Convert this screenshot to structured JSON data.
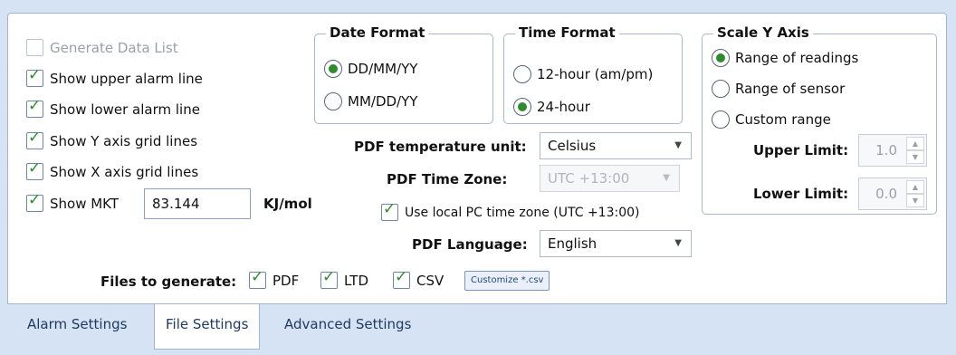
{
  "options": {
    "generate_data_list": "Generate Data List",
    "show_upper_alarm": "Show upper alarm line",
    "show_lower_alarm": "Show lower alarm line",
    "show_y_grid": "Show Y axis grid lines",
    "show_x_grid": "Show X axis grid lines",
    "show_mkt": "Show MKT",
    "mkt_value": "83.144",
    "mkt_unit": "KJ/mol"
  },
  "date_format": {
    "legend": "Date Format",
    "opt1": "DD/MM/YY",
    "opt2": "MM/DD/YY",
    "selected": "DD/MM/YY"
  },
  "time_format": {
    "legend": "Time Format",
    "opt1": "12-hour (am/pm)",
    "opt2": "24-hour",
    "selected": "24-hour"
  },
  "scale_y": {
    "legend": "Scale Y Axis",
    "opt1": "Range of readings",
    "opt2": "Range of sensor",
    "opt3": "Custom range",
    "selected": "Range of readings",
    "upper_label": "Upper Limit:",
    "upper_value": "1.0",
    "lower_label": "Lower Limit:",
    "lower_value": "0.0"
  },
  "pdf": {
    "temp_unit_label": "PDF temperature unit:",
    "temp_unit_value": "Celsius",
    "time_zone_label": "PDF Time Zone:",
    "time_zone_value": "UTC +13:00",
    "use_local_tz": "Use local PC time zone (UTC +13:00)",
    "language_label": "PDF Language:",
    "language_value": "English"
  },
  "files": {
    "label": "Files to generate:",
    "pdf": "PDF",
    "ltd": "LTD",
    "csv": "CSV",
    "customize": "Customize *.csv"
  },
  "tabs": {
    "alarm": "Alarm Settings",
    "file": "File Settings",
    "advanced": "Advanced Settings",
    "active": "File Settings"
  },
  "colors": {
    "accent_check": "#2e8b2e",
    "background": "#d6e3f4",
    "tab_text": "#1e3a62"
  }
}
